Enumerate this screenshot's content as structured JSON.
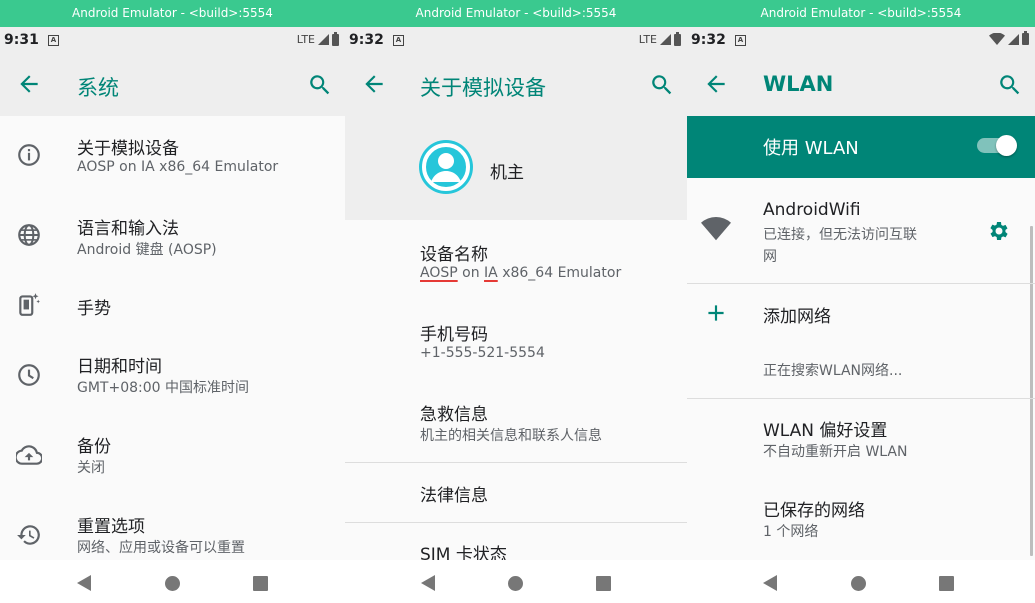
{
  "window_title": "Android Emulator - <build>:5554",
  "colors": {
    "accent": "#008577",
    "title_strip": "#3ac98f",
    "avatar": "#26c6da"
  },
  "panels": {
    "system": {
      "time": "9:31",
      "network": "LTE",
      "title": "系统",
      "items": [
        {
          "title": "关于模拟设备",
          "subtitle": "AOSP on IA x86_64 Emulator",
          "icon": "info-icon"
        },
        {
          "title": "语言和输入法",
          "subtitle": "Android 键盘 (AOSP)",
          "icon": "globe-icon"
        },
        {
          "title": "手势",
          "subtitle": "",
          "icon": "gesture-phone-icon"
        },
        {
          "title": "日期和时间",
          "subtitle": "GMT+08:00 中国标准时间",
          "icon": "clock-icon"
        },
        {
          "title": "备份",
          "subtitle": "关闭",
          "icon": "cloud-upload-icon"
        },
        {
          "title": "重置选项",
          "subtitle": "网络、应用或设备可以重置",
          "icon": "restore-icon"
        }
      ]
    },
    "about": {
      "time": "9:32",
      "network": "LTE",
      "title": "关于模拟设备",
      "owner": "机主",
      "device_name": {
        "title": "设备名称",
        "subtitle_parts": [
          "AOSP",
          " on ",
          "IA",
          " x86_64 Emulator"
        ]
      },
      "phone": {
        "title": "手机号码",
        "subtitle": "+1-555-521-5554"
      },
      "emergency": {
        "title": "急救信息",
        "subtitle": "机主的相关信息和联系人信息"
      },
      "legal": {
        "title": "法律信息"
      },
      "sim": {
        "title": "SIM 卡状态"
      }
    },
    "wlan": {
      "time": "9:32",
      "title": "WLAN",
      "use_wlan": "使用 WLAN",
      "toggle_on": true,
      "network": {
        "name": "AndroidWifi",
        "status_line1": "已连接，但无法访问互联",
        "status_line2": "网"
      },
      "add_network": "添加网络",
      "searching": "正在搜索WLAN网络...",
      "prefs": {
        "title": "WLAN 偏好设置",
        "subtitle": "不自动重新开启 WLAN"
      },
      "saved": {
        "title": "已保存的网络",
        "subtitle": "1 个网络"
      }
    }
  }
}
